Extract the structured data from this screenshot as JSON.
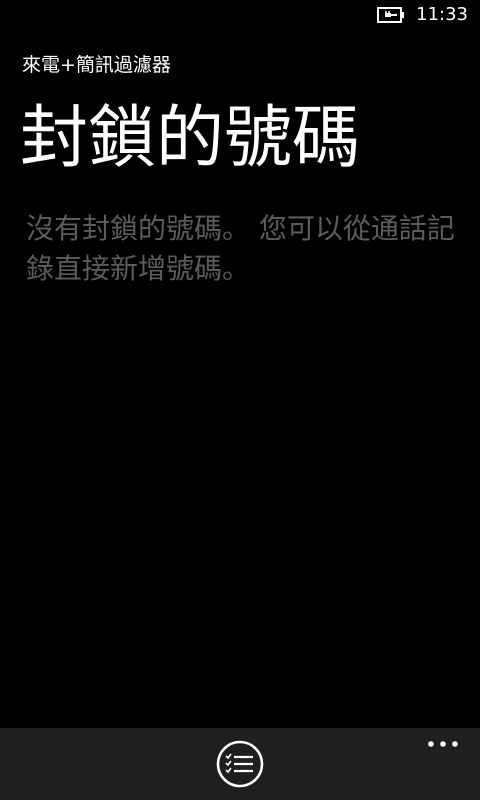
{
  "status_bar": {
    "battery_icon": "battery-charging-icon",
    "time": "11:33"
  },
  "header": {
    "app_title": "來電+簡訊過濾器",
    "page_title": "封鎖的號碼"
  },
  "main": {
    "empty_message": "沒有封鎖的號碼。 您可以從通話記錄直接新增號碼。"
  },
  "app_bar": {
    "primary_button_icon": "checklist-icon",
    "more_icon": "more-dots-icon"
  },
  "colors": {
    "background": "#000000",
    "text": "#ffffff",
    "secondary_text": "#5c5c5c",
    "app_bar": "#1f1f1f"
  }
}
